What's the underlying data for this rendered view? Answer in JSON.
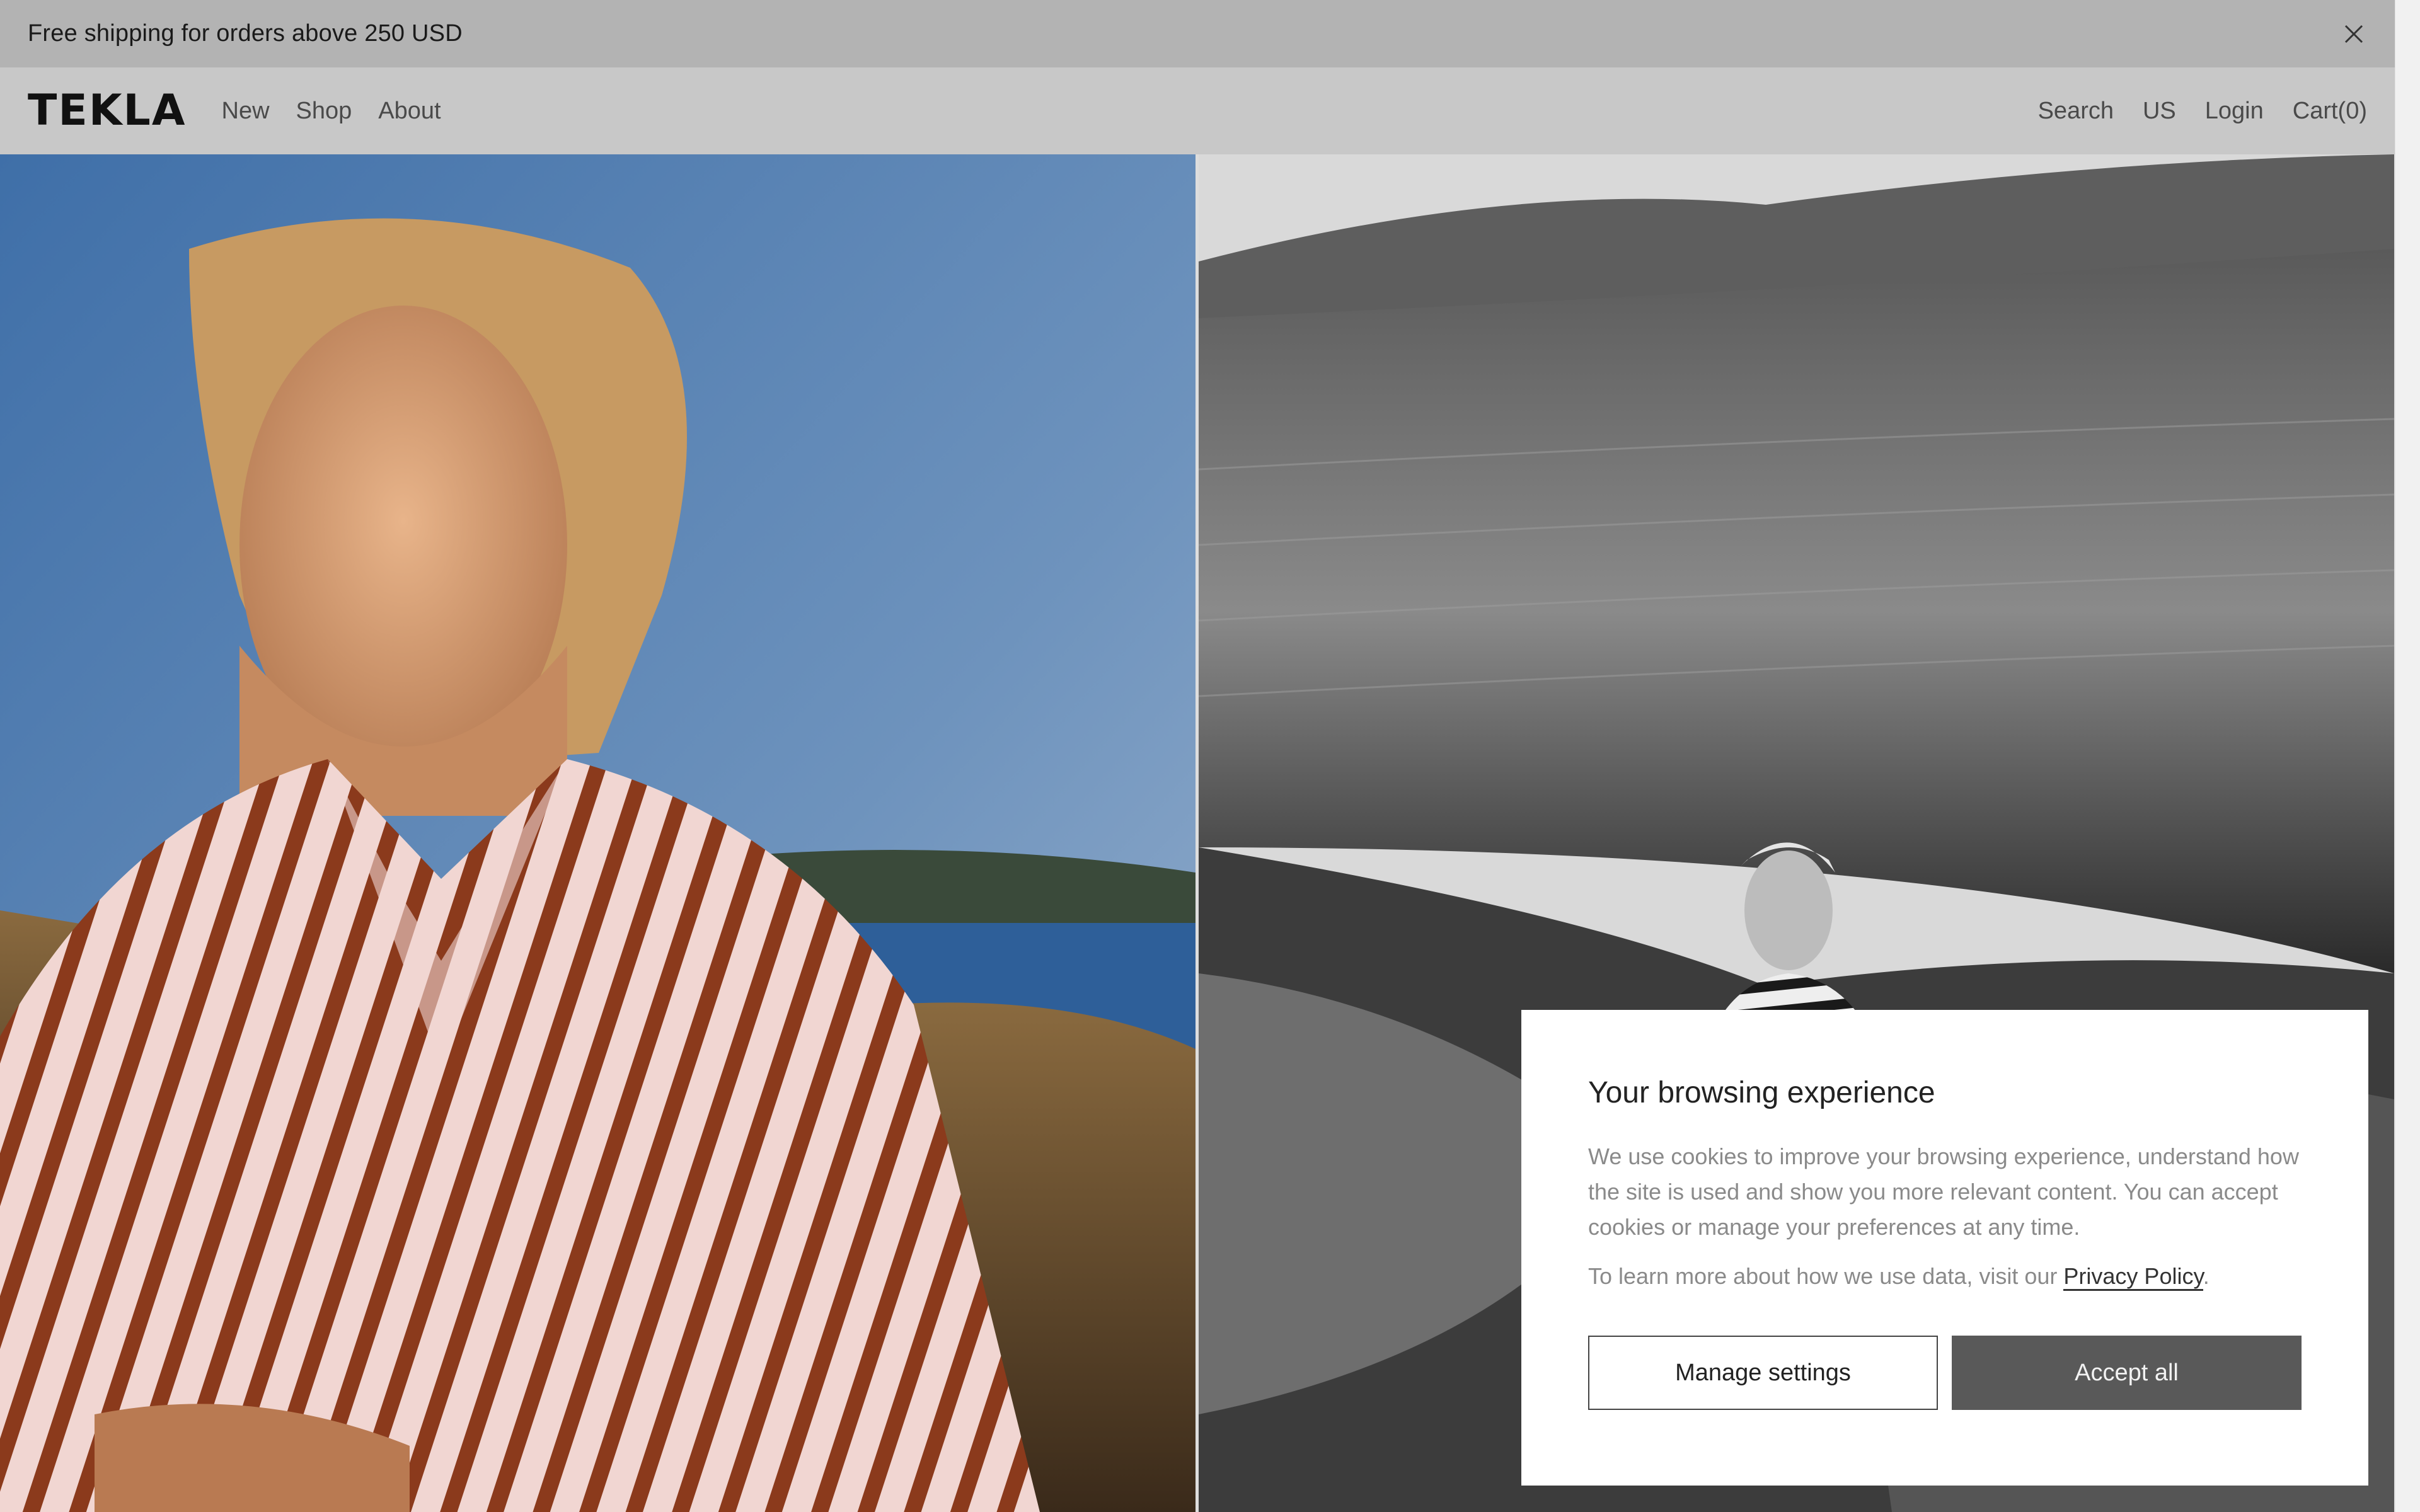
{
  "announcement": {
    "text": "Free shipping for orders above 250 USD",
    "close_icon": "close-icon"
  },
  "header": {
    "logo": "TEKLA",
    "nav_left": [
      "New",
      "Shop",
      "About"
    ],
    "nav_right": {
      "search": "Search",
      "region": "US",
      "login": "Login",
      "cart": "Cart(0)"
    }
  },
  "hero": {
    "left_image": "woman in red-and-white striped robe by the sea",
    "right_image": "black-and-white photo of woman in striped top sitting on rocks by water"
  },
  "cookie_dialog": {
    "title": "Your browsing experience",
    "body": "We use cookies to improve your browsing experience, understand how the site is used and show you more relevant content. You can accept cookies or manage your preferences at any time.",
    "learn_more_prefix": "To learn more about how we use data, visit our ",
    "privacy_link": "Privacy Policy",
    "learn_more_suffix": ".",
    "manage_button": "Manage settings",
    "accept_button": "Accept all"
  },
  "colors": {
    "announcement_bg": "#b3b3b3",
    "header_bg": "#c8c8c8",
    "accept_bg": "#595959"
  }
}
